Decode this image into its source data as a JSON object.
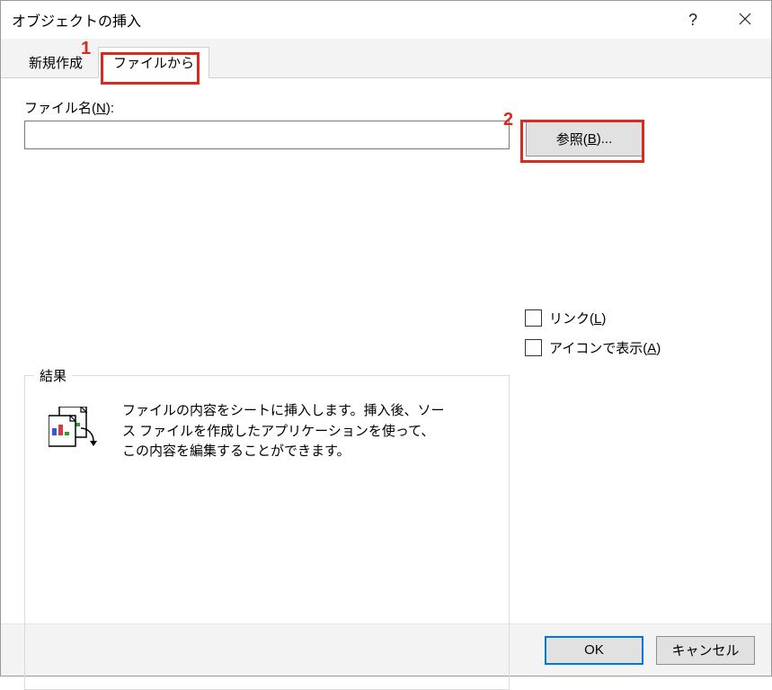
{
  "title": "オブジェクトの挿入",
  "tabs": {
    "new": "新規作成",
    "fromfile": "ファイルから"
  },
  "filename": {
    "label_pre": "ファイル名(",
    "label_u": "N",
    "label_post": "):",
    "value": "",
    "browse_pre": "参照(",
    "browse_u": "B",
    "browse_post": ")..."
  },
  "checks": {
    "link_pre": "リンク(",
    "link_u": "L",
    "link_post": ")",
    "icon_pre": "アイコンで表示(",
    "icon_u": "A",
    "icon_post": ")"
  },
  "result": {
    "legend": "結果",
    "text": "ファイルの内容をシートに挿入します。挿入後、ソース ファイルを作成したアプリケーションを使って、この内容を編集することができます。"
  },
  "footer": {
    "ok": "OK",
    "cancel": "キャンセル"
  },
  "annotations": {
    "n1": "1",
    "n2": "2"
  }
}
